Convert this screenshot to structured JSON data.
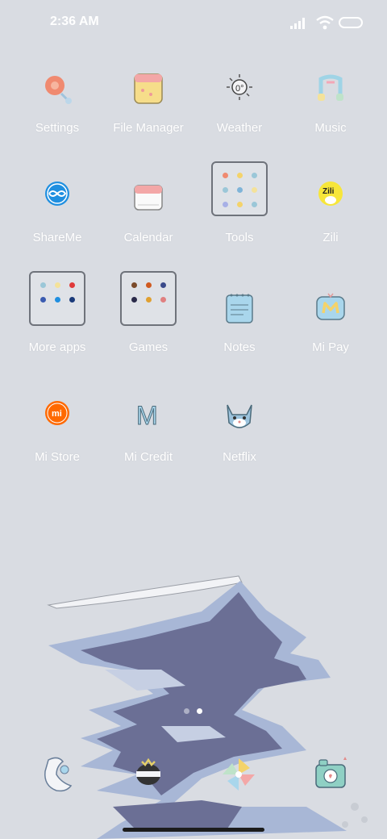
{
  "status_bar": {
    "time": "2:36 AM",
    "signal_icon": "signal-icon",
    "wifi_icon": "wifi-icon",
    "battery_icon": "battery-icon"
  },
  "apps": [
    {
      "label": "Settings",
      "icon": "settings-icon"
    },
    {
      "label": "File Manager",
      "icon": "file-manager-icon"
    },
    {
      "label": "Weather",
      "icon": "weather-icon"
    },
    {
      "label": "Music",
      "icon": "music-icon"
    },
    {
      "label": "ShareMe",
      "icon": "shareme-icon"
    },
    {
      "label": "Calendar",
      "icon": "calendar-icon"
    },
    {
      "label": "Tools",
      "icon": "folder-icon"
    },
    {
      "label": "Zili",
      "icon": "zili-icon",
      "icon_text": "Zili"
    },
    {
      "label": "More apps",
      "icon": "folder-icon"
    },
    {
      "label": "Games",
      "icon": "folder-icon"
    },
    {
      "label": "Notes",
      "icon": "notes-icon"
    },
    {
      "label": "Mi Pay",
      "icon": "mi-pay-icon"
    },
    {
      "label": "Mi Store",
      "icon": "mi-store-icon",
      "icon_text": "mi"
    },
    {
      "label": "Mi Credit",
      "icon": "mi-credit-icon",
      "icon_text": "M"
    },
    {
      "label": "Netflix",
      "icon": "netflix-icon"
    }
  ],
  "dock": [
    {
      "icon": "phone-icon"
    },
    {
      "icon": "messages-icon"
    },
    {
      "icon": "browser-icon"
    },
    {
      "icon": "camera-icon"
    }
  ],
  "page_indicator": {
    "pages": 2,
    "current": 2
  },
  "colors": {
    "background": "#d9dce2",
    "water": "#6b6f95",
    "ice": "#a8b7d6",
    "mi_orange": "#ff6900"
  }
}
